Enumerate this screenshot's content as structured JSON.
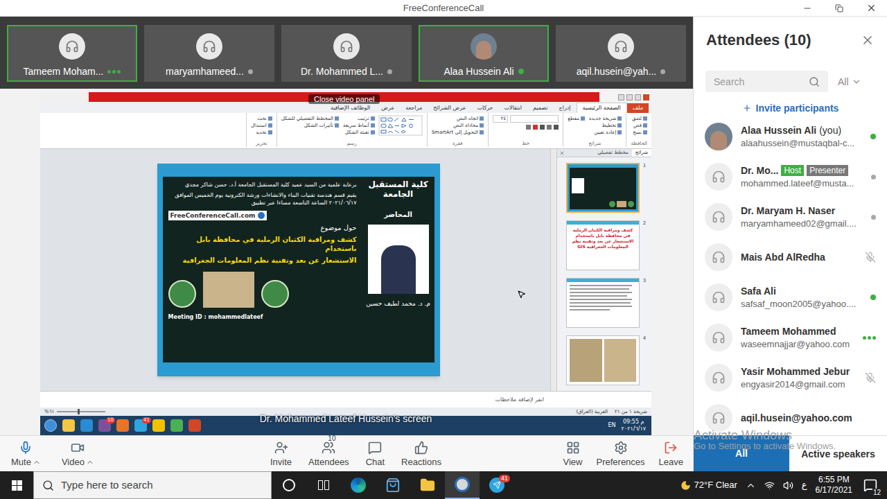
{
  "window": {
    "title": "FreeConferenceCall"
  },
  "video_tiles": [
    {
      "name": "Tameem Moham...",
      "active": true,
      "status": "speaking",
      "photo": false
    },
    {
      "name": "maryamhameed...",
      "active": false,
      "status": "idle",
      "photo": false
    },
    {
      "name": "Dr. Mohammed L...",
      "active": false,
      "status": "idle",
      "photo": false
    },
    {
      "name": "Alaa Hussein Ali",
      "active": true,
      "status": "online",
      "photo": true
    },
    {
      "name": "aqil.husein@yah...",
      "active": false,
      "status": "idle",
      "photo": false
    }
  ],
  "close_video_panel": "Close video panel",
  "screen_caption": "Dr. Mohammed Lateef Hussein's screen",
  "shared_screen": {
    "ribbon_tabs": [
      {
        "label": "ملف",
        "selected": false,
        "kind": "file"
      },
      {
        "label": "الصفحة الرئيسية",
        "selected": true,
        "kind": "tab"
      },
      {
        "label": "إدراج",
        "selected": false,
        "kind": "tab"
      },
      {
        "label": "تصميم",
        "selected": false,
        "kind": "tab"
      },
      {
        "label": "انتقالات",
        "selected": false,
        "kind": "tab"
      },
      {
        "label": "حركات",
        "selected": false,
        "kind": "tab"
      },
      {
        "label": "عرض الشرائح",
        "selected": false,
        "kind": "tab"
      },
      {
        "label": "مراجعة",
        "selected": false,
        "kind": "tab"
      },
      {
        "label": "عرض",
        "selected": false,
        "kind": "tab"
      },
      {
        "label": "الوظائف الإضافية",
        "selected": false,
        "kind": "tab"
      }
    ],
    "ribbon_groups": [
      {
        "label": "الحافظة",
        "kind": "list",
        "items": [
          "لصق",
          "قص",
          "نسخ"
        ]
      },
      {
        "label": "شرائح",
        "kind": "list",
        "items": [
          "شريحة جديدة",
          "تخطيط",
          "إعادة تعيين",
          "مقطع"
        ]
      },
      {
        "label": "خط",
        "kind": "font",
        "items": [
          "٢٤"
        ]
      },
      {
        "label": "فقرة",
        "kind": "list",
        "items": [
          "اتجاه النص",
          "محاذاة النص",
          "التحويل إلى SmartArt"
        ]
      },
      {
        "label": "رسم",
        "kind": "shapes",
        "items": [
          "ترتيب",
          "أنماط سريعة",
          "تعبئة الشكل",
          "المخطط التفصيلي للشكل",
          "تأثيرات الشكل"
        ]
      },
      {
        "label": "تحرير",
        "kind": "list",
        "items": [
          "بحث",
          "استبدال",
          "تحديد"
        ]
      }
    ],
    "slide": {
      "college_logo": "كلية المستقبل الجامعة",
      "lecturer_label": "المحاضر",
      "lecturer_name": "م. د. محمد لطيف حسين",
      "sponsor": "برعاية علمية من السيد عميد كلية المستقبل الجامعة أ.د. حسن شاكر مجدي",
      "event": "يقيم قسم هندسة تقنيات البناء والانشاءات ورشة الكترونية يوم الخميس الموافق ٢٠٢١/٠٦/١٧ الساعة التاسعة مساءا عبر تطبيق",
      "app_logo": "FreeConferenceCall.com",
      "topic_label": "حول موضوع",
      "topic_lines": [
        "كشف ومراقبة الكثبان الرملية في محافظة بابل باستخدام",
        "الاستشعار عن بعد وتقنية نظم المعلومات الجغرافية"
      ],
      "meeting_id": "Meeting ID : mohammedlateef"
    },
    "thumbnail_tabs": [
      {
        "label": "شرائح",
        "selected": true
      },
      {
        "label": "مخطط تفصيلي",
        "selected": false
      }
    ],
    "thumbnails": [
      {
        "number": "1",
        "selected": true,
        "kind": "title",
        "text": ""
      },
      {
        "number": "2",
        "selected": false,
        "kind": "heading",
        "text": "كشف ومراقبة الكثبان الرملية في محافظة بابل باستخدام الاستشعار عن بعد وتقنية نظم المعلومات الجغرافية GIS"
      },
      {
        "number": "3",
        "selected": false,
        "kind": "text",
        "text": ""
      },
      {
        "number": "4",
        "selected": false,
        "kind": "photos",
        "text": ""
      }
    ],
    "notes_placeholder": "انقر لإضافة ملاحظات",
    "status_bar": {
      "zoom": "%٦١",
      "items": [
        "شريحة ١ من ٢١",
        "العربية (العراق)"
      ]
    },
    "taskbar": {
      "apps": [
        {
          "kind": "start"
        },
        {
          "kind": "explorer"
        },
        {
          "kind": "ie"
        },
        {
          "kind": "viber",
          "badge": "10"
        },
        {
          "kind": "media"
        },
        {
          "kind": "telegram",
          "badge": "41"
        },
        {
          "kind": "norton"
        },
        {
          "kind": "chrome"
        },
        {
          "kind": "ppt"
        }
      ],
      "language": "EN",
      "time": "09:55 م",
      "date": "٢٠٢١/٦/١٧"
    }
  },
  "sidebar": {
    "title": "Attendees (10)",
    "search_placeholder": "Search",
    "filter": "All",
    "invite": "Invite participants",
    "attendees": [
      {
        "name": "Alaa Hussein Ali",
        "suffix": "(you)",
        "badges": [],
        "email": "alaahussein@mustaqbal-c...",
        "status": "online",
        "photo": true
      },
      {
        "name": "Dr. Mo...",
        "suffix": "",
        "badges": [
          "Host",
          "Presenter"
        ],
        "email": "mohammed.lateef@musta...",
        "status": "idle",
        "photo": false
      },
      {
        "name": "Dr. Maryam H. Naser",
        "suffix": "",
        "badges": [],
        "email": "maryamhameed02@gmail....",
        "status": "idle",
        "photo": false
      },
      {
        "name": "Mais Abd AlRedha",
        "suffix": "",
        "badges": [],
        "email": "",
        "status": "muted",
        "photo": false
      },
      {
        "name": "Safa Ali",
        "suffix": "",
        "badges": [],
        "email": "safsaf_moon2005@yahoo....",
        "status": "online",
        "photo": false
      },
      {
        "name": "Tameem Mohammed",
        "suffix": "",
        "badges": [],
        "email": "waseemnajjar@yahoo.com",
        "status": "speaking",
        "photo": false
      },
      {
        "name": "Yasir Mohammed Jebur",
        "suffix": "",
        "badges": [],
        "email": "engyasir2014@gmail.com",
        "status": "muted",
        "photo": false
      },
      {
        "name": "aqil.husein@yahoo.com",
        "suffix": "",
        "badges": [],
        "email": "",
        "status": "none",
        "photo": false
      }
    ]
  },
  "watermark": {
    "title": "Activate Windows",
    "subtitle": "Go to Settings to activate Windows."
  },
  "toolbar": {
    "left": [
      {
        "label": "Mute",
        "kind": "mic",
        "menu": true
      },
      {
        "label": "Video",
        "kind": "video",
        "menu": true
      }
    ],
    "center": [
      {
        "label": "Invite",
        "kind": "invite",
        "menu": false
      },
      {
        "label": "Attendees",
        "kind": "attendees",
        "menu": false,
        "badge": "10"
      },
      {
        "label": "Chat",
        "kind": "chat",
        "menu": false
      },
      {
        "label": "Reactions",
        "kind": "reactions",
        "menu": false
      }
    ],
    "right": [
      {
        "label": "View",
        "kind": "view",
        "menu": false
      },
      {
        "label": "Preferences",
        "kind": "preferences",
        "menu": false
      },
      {
        "label": "Leave",
        "kind": "leave",
        "menu": false
      }
    ]
  },
  "bottom_tabs": [
    {
      "label": "All",
      "selected": true
    },
    {
      "label": "Active speakers",
      "selected": false
    }
  ],
  "taskbar": {
    "search_placeholder": "Type here to search",
    "apps": [
      {
        "kind": "cortana",
        "selected": false
      },
      {
        "kind": "taskview",
        "selected": false
      },
      {
        "kind": "edge",
        "selected": false
      },
      {
        "kind": "store",
        "selected": false
      },
      {
        "kind": "explorer",
        "selected": false
      },
      {
        "kind": "conference",
        "selected": true
      },
      {
        "kind": "telegram",
        "selected": false,
        "badge": "41"
      }
    ],
    "weather": "72°F Clear",
    "input_language": "ع",
    "time": "6:55 PM",
    "date": "6/17/2021",
    "notifications": "12"
  }
}
